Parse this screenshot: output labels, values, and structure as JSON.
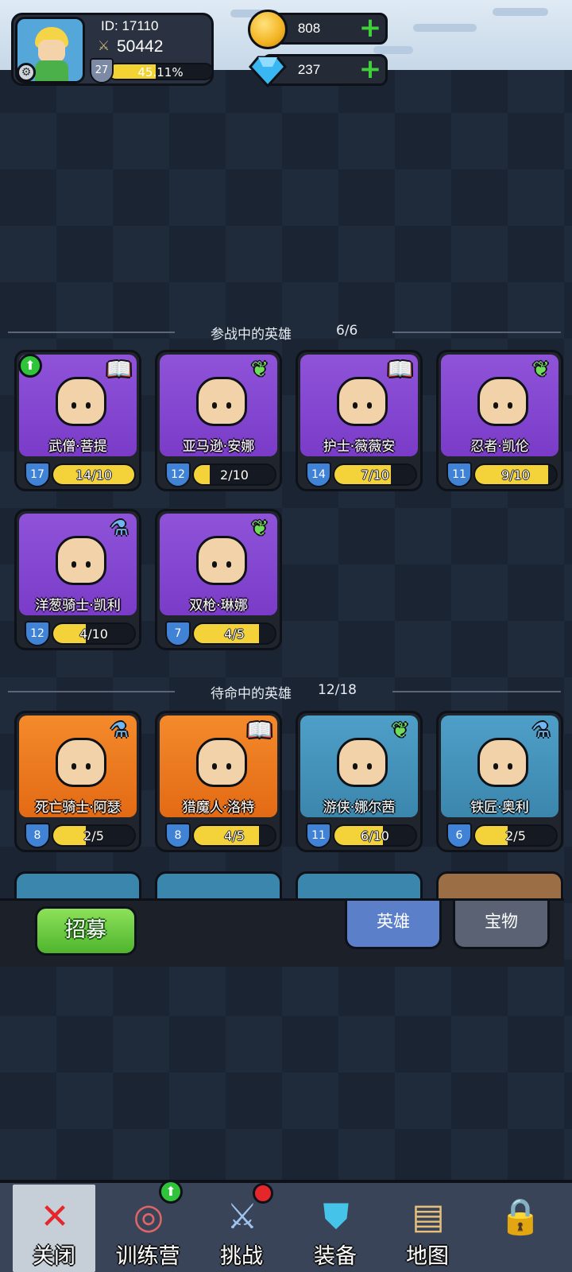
{
  "player": {
    "id_label": "ID: 17110",
    "power": "50442",
    "level": "27",
    "xp_percent_text": "45.11%",
    "xp_fraction": 0.4511
  },
  "currency": {
    "gold": "808",
    "gems": "237"
  },
  "deployed": {
    "label": "参战中的英雄",
    "count": "6/6",
    "heroes": [
      {
        "name": "武僧·菩提",
        "level": "17",
        "shards": "14/10",
        "fill": 1.0,
        "badge": "book",
        "upgradable": true,
        "color": "purple"
      },
      {
        "name": "亚马逊·安娜",
        "level": "12",
        "shards": "2/10",
        "fill": 0.2,
        "badge": "wing",
        "upgradable": false,
        "color": "purple"
      },
      {
        "name": "护士·薇薇安",
        "level": "14",
        "shards": "7/10",
        "fill": 0.7,
        "badge": "book",
        "upgradable": false,
        "color": "purple"
      },
      {
        "name": "忍者·凯伦",
        "level": "11",
        "shards": "9/10",
        "fill": 0.9,
        "badge": "wing",
        "upgradable": false,
        "color": "purple"
      },
      {
        "name": "洋葱骑士·凯利",
        "level": "12",
        "shards": "4/10",
        "fill": 0.4,
        "badge": "potion",
        "upgradable": false,
        "color": "purple"
      },
      {
        "name": "双枪·琳娜",
        "level": "7",
        "shards": "4/5",
        "fill": 0.8,
        "badge": "wing",
        "upgradable": false,
        "color": "purple"
      }
    ]
  },
  "standby": {
    "label": "待命中的英雄",
    "count": "12/18",
    "heroes": [
      {
        "name": "死亡骑士·阿瑟",
        "level": "8",
        "shards": "2/5",
        "fill": 0.4,
        "badge": "potion",
        "color": "orange"
      },
      {
        "name": "猎魔人·洛特",
        "level": "8",
        "shards": "4/5",
        "fill": 0.8,
        "badge": "book",
        "color": "orange"
      },
      {
        "name": "游侠·娜尔茜",
        "level": "11",
        "shards": "6/10",
        "fill": 0.6,
        "badge": "wing",
        "color": "blue"
      },
      {
        "name": "铁匠·奥利",
        "level": "6",
        "shards": "2/5",
        "fill": 0.4,
        "badge": "potion",
        "color": "blue"
      }
    ]
  },
  "actions": {
    "recruit": "招募",
    "tab_heroes": "英雄",
    "tab_treasure": "宝物"
  },
  "nav": {
    "close": "关闭",
    "training": "训练营",
    "challenge": "挑战",
    "equipment": "装备",
    "map": "地图"
  },
  "colors": {
    "gold": "#f4d23a",
    "accent_green": "#3fd13a",
    "tab_active": "#5c7fc9"
  }
}
